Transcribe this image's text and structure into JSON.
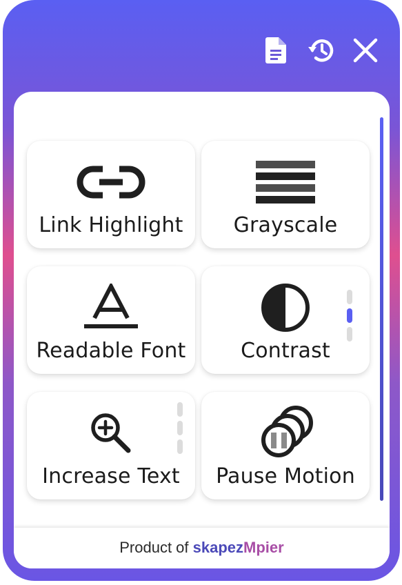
{
  "header": {
    "icons": [
      {
        "name": "document-icon"
      },
      {
        "name": "history-icon"
      },
      {
        "name": "close-icon"
      }
    ]
  },
  "cards": [
    {
      "label": "Link Highlight",
      "icon": "link-icon"
    },
    {
      "label": "Grayscale",
      "icon": "grayscale-icon"
    },
    {
      "label": "Readable Font",
      "icon": "font-icon"
    },
    {
      "label": "Contrast",
      "icon": "contrast-icon",
      "level": "2 of 3"
    },
    {
      "label": "Increase Text",
      "icon": "zoom-in-icon",
      "level": "0 of 3"
    },
    {
      "label": "Pause Motion",
      "icon": "pause-motion-icon"
    }
  ],
  "footer": {
    "prefix": "Product of",
    "brand_part1": "skapez",
    "brand_part2": "Mpier"
  },
  "colors": {
    "accent": "#5a5ff2",
    "gradient_pink": "#df4f8f",
    "gradient_purple": "#7a55d6",
    "icon_dark": "#1f1f1f"
  }
}
